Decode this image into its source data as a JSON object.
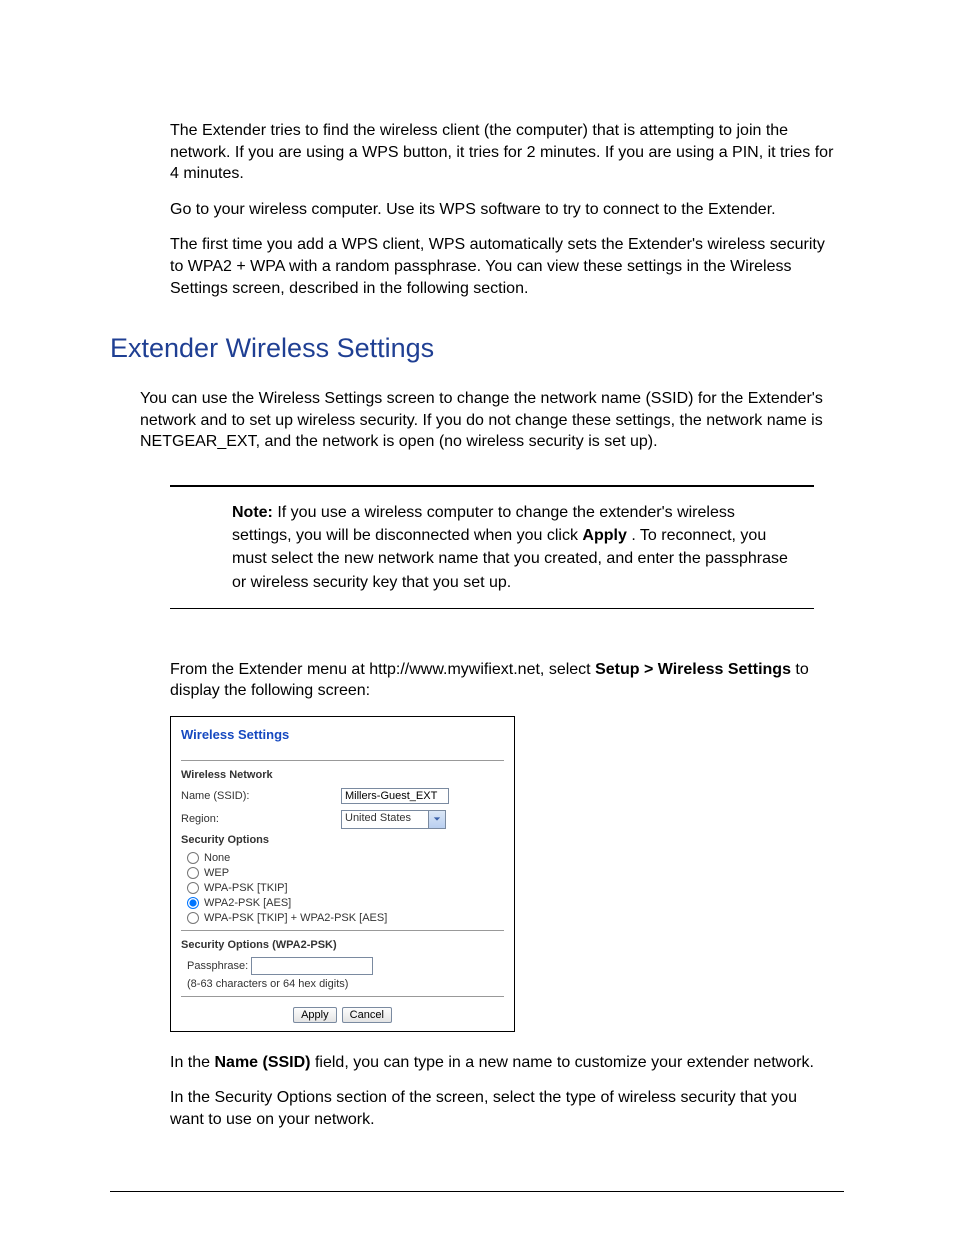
{
  "bullets": {
    "b1": "The Extender tries to find the wireless client (the computer) that is attempting to join the network. If you are using a WPS button, it tries for 2 minutes. If you are using a PIN, it tries for 4 minutes.",
    "b2": "Go to your wireless computer. Use its WPS software to try to connect to the Extender.",
    "b3": "The first time you add a WPS client, WPS automatically sets the Extender's wireless security to WPA2 + WPA with a random passphrase. You can view these settings in the Wireless Settings screen, described in the following section."
  },
  "heading": "Extender Wireless Settings",
  "intro": "You can use the Wireless Settings screen to change the network name (SSID) for the Extender's network and to set up wireless security. If you do not change these settings, the network name is NETGEAR_EXT, and the network is open (no wireless security is set up).",
  "callout": {
    "title": "Note:",
    "line1a": "If you use a wireless computer to change the extender's wireless settings, you will be disconnected when you click ",
    "applyWord": "Apply",
    "line1b": ". To reconnect, you must select the new network name that you created, and enter the passphrase or wireless security key that you set up."
  },
  "nav": {
    "pre": "From the Extender menu at http://www.mywifiext.net, select ",
    "bold": "Setup > Wireless Settings",
    "post": " to display the following screen:"
  },
  "screenshot": {
    "title": "Wireless Settings",
    "networkHead": "Wireless Network",
    "nameLabel": "Name (SSID):",
    "nameValue": "Millers-Guest_EXT",
    "regionLabel": "Region:",
    "regionValue": "United States",
    "secHead": "Security Options",
    "options": {
      "o1": "None",
      "o2": "WEP",
      "o3": "WPA-PSK [TKIP]",
      "o4": "WPA2-PSK [AES]",
      "o5": "WPA-PSK [TKIP] + WPA2-PSK [AES]"
    },
    "secHead2": "Security Options (WPA2-PSK)",
    "ppLabel": "Passphrase:",
    "ppHint": "(8-63 characters or 64 hex digits)",
    "applyBtn": "Apply",
    "cancelBtn": "Cancel"
  },
  "after": {
    "p1a": "In the ",
    "p1bold": "Name (SSID)",
    "p1b": " field, you can type in a new name to customize your extender network.",
    "p2": "In the Security Options section of the screen, select the type of wireless security that you want to use on your network."
  }
}
